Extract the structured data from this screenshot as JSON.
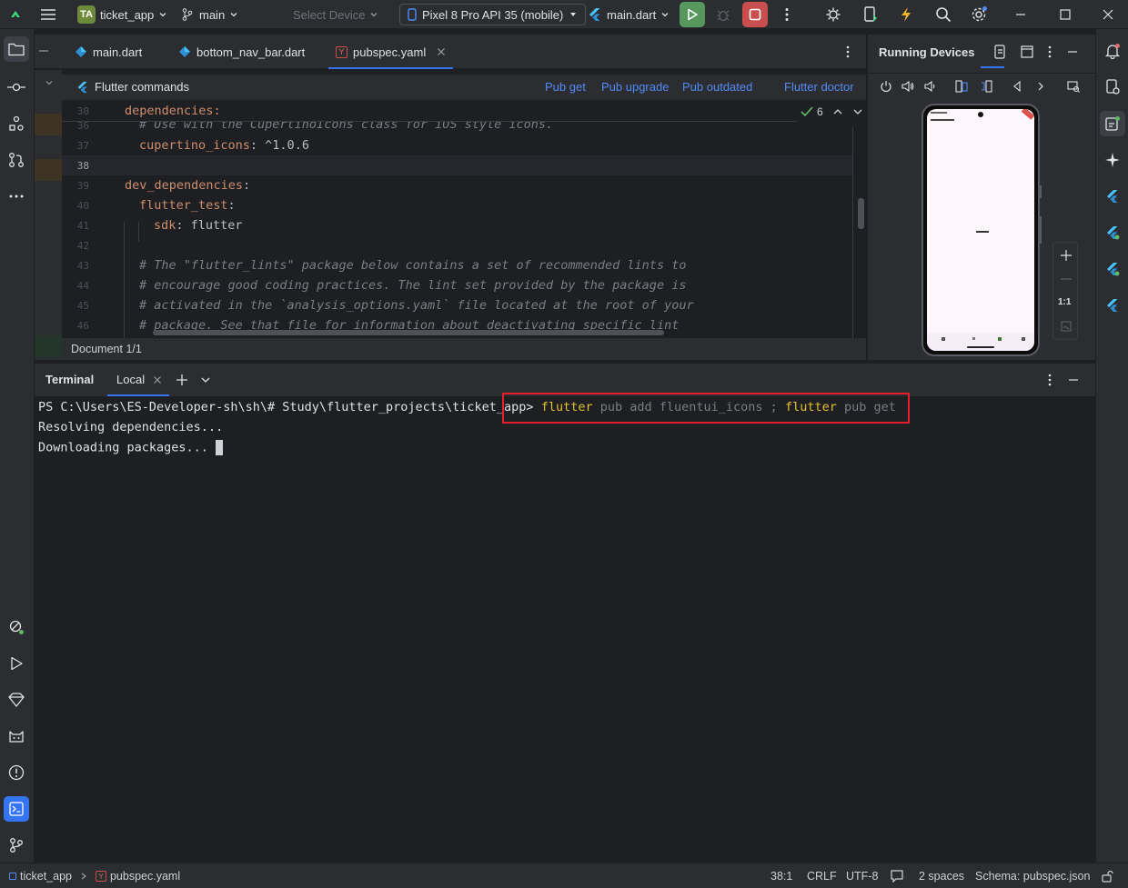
{
  "titlebar": {
    "project_badge": "TA",
    "project": "ticket_app",
    "branch": "main",
    "select_device": "Select Device",
    "device": "Pixel 8 Pro API 35 (mobile)",
    "run_config": "main.dart"
  },
  "tabs": [
    {
      "label": "main.dart"
    },
    {
      "label": "bottom_nav_bar.dart"
    },
    {
      "label": "pubspec.yaml"
    }
  ],
  "flutter_commands": {
    "title": "Flutter commands",
    "pub_get": "Pub get",
    "pub_upgrade": "Pub upgrade",
    "pub_outdated": "Pub outdated",
    "flutter_doctor": "Flutter doctor"
  },
  "editor": {
    "sticky_line": "30",
    "sticky_text": "dependencies:",
    "inspection_count": "6",
    "lines": [
      {
        "n": "36",
        "text": "# Use with the CupertinoIcons class for iOS style icons."
      },
      {
        "n": "37",
        "key": "cupertino_icons",
        "value": ": ^1.0.6"
      },
      {
        "n": "38",
        "text": ""
      },
      {
        "n": "39",
        "key": "dev_dependencies",
        "value": ":"
      },
      {
        "n": "40",
        "key": "flutter_test",
        "value": ":"
      },
      {
        "n": "41",
        "key": "sdk",
        "value": ": flutter"
      },
      {
        "n": "42",
        "text": ""
      },
      {
        "n": "43",
        "text": "# The \"flutter_lints\" package below contains a set of recommended lints to"
      },
      {
        "n": "44",
        "text": "# encourage good coding practices. The lint set provided by the package is"
      },
      {
        "n": "45",
        "text": "# activated in the `analysis_options.yaml` file located at the root of your"
      },
      {
        "n": "46",
        "text": "# package. See that file for information about deactivating specific lint"
      }
    ],
    "document_info": "Document 1/1"
  },
  "running_devices": {
    "title": "Running Devices",
    "zoom_label": "1:1"
  },
  "terminal": {
    "title": "Terminal",
    "tab": "Local",
    "prompt": "PS C:\\Users\\ES-Developer-sh\\sh\\# Study\\flutter_projects\\ticket_app>",
    "cmd1_word": "flutter",
    "cmd1_rest": " pub add fluentui_icons ;",
    "cmd2_word": "flutter",
    "cmd2_rest": " pub get",
    "output": [
      "Resolving dependencies...",
      "Downloading packages..."
    ]
  },
  "statusbar": {
    "project": "ticket_app",
    "file": "pubspec.yaml",
    "position": "38:1",
    "line_sep": "CRLF",
    "encoding": "UTF-8",
    "indent": "2 spaces",
    "schema": "Schema: pubspec.json"
  },
  "colors": {
    "accent": "#3574f0",
    "highlight_box": "#e5202a",
    "run_green": "#57965c",
    "stop_red": "#c94f4f"
  }
}
